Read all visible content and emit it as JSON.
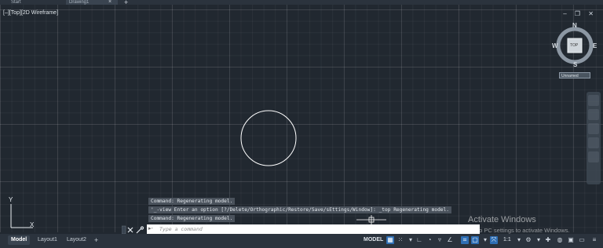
{
  "colors": {
    "canvas_bg": "#212830",
    "accent": "#2f6fb5",
    "command_bg": "#4a525c"
  },
  "file_tabs": {
    "start": "Start",
    "drawing": "Drawing1",
    "close": "×",
    "add": "+"
  },
  "viewport": {
    "label": "[–][Top][2D Wireframe]",
    "window_controls": "‒ ❐ ✕"
  },
  "viewcube": {
    "top_face": "TOP",
    "north": "N",
    "east": "E",
    "south": "S",
    "west": "W",
    "ucs": "Unnamed"
  },
  "ucs_icon": {
    "x_label": "X",
    "y_label": "Y"
  },
  "command": {
    "history": [
      "Command: Regenerating model.",
      "'_-view Enter an option [?/Delete/Orthographic/Restore/Save/sEttings/Window]: _top Regenerating model.",
      "Command: Regenerating model."
    ],
    "placeholder": "Type a command",
    "prompt_icon": "▸-"
  },
  "watermark": {
    "title": "Activate Windows",
    "subtitle": "Go to PC settings to activate Windows."
  },
  "layout_tabs": {
    "model": "Model",
    "layout1": "Layout1",
    "layout2": "Layout2",
    "add": "+"
  },
  "status": {
    "model": "MODEL",
    "scale": "1:1"
  },
  "icons": [
    "grid-icon",
    "snap-icon",
    "ortho-icon",
    "polar-icon",
    "isodraft-icon",
    "osnap-track-icon",
    "osnap-icon",
    "lineweight-icon",
    "transparency-icon",
    "selection-cycling-icon",
    "annotation-scale-icon",
    "workspace-gear-icon",
    "plus-icon",
    "isolate-icon",
    "hardware-icon",
    "fullscreen-icon",
    "customize-icon"
  ]
}
